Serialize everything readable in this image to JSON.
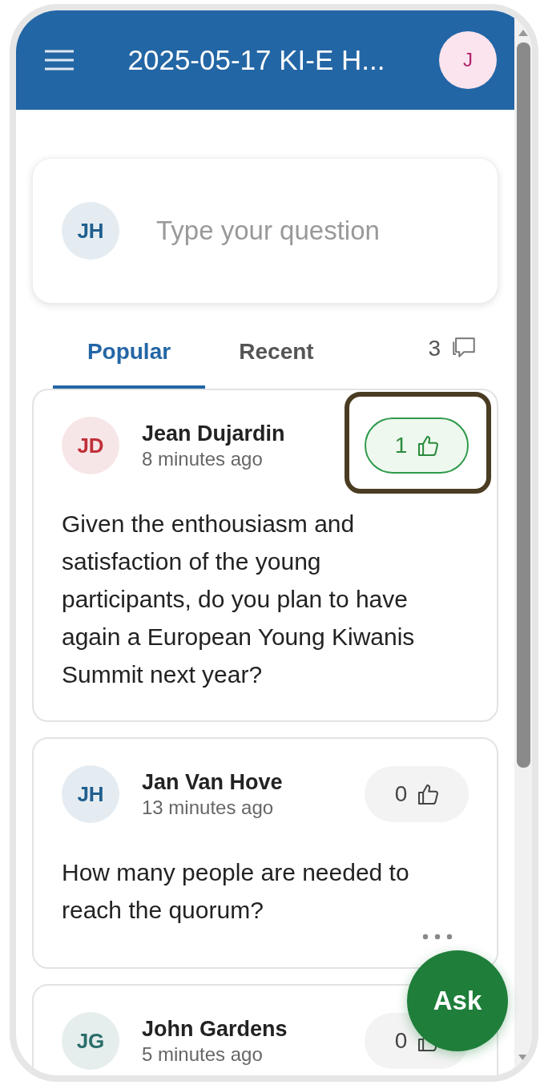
{
  "header": {
    "title": "2025-05-17 KI-E H...",
    "user_initials": "J"
  },
  "composer": {
    "initials": "JH",
    "color": "#1f5f8f",
    "placeholder": "Type your question"
  },
  "tabs": [
    {
      "label": "Popular",
      "selected": true
    },
    {
      "label": "Recent",
      "selected": false
    }
  ],
  "question_count": "3",
  "questions": [
    {
      "initials": "JD",
      "color": "#c0303a",
      "author": "Jean Dujardin",
      "time": "8 minutes ago",
      "votes": "1",
      "voted": true,
      "highlighted": true,
      "menu_visible": false,
      "text": "Given the enthousiasm and satisfaction of the young participants, do you plan to have again a European Young Kiwanis Summit next year?"
    },
    {
      "initials": "JH",
      "color": "#1f5f8f",
      "author": "Jan Van Hove",
      "time": "13 minutes ago",
      "votes": "0",
      "voted": false,
      "highlighted": false,
      "menu_visible": true,
      "text": "How many people are needed to reach the quorum?"
    },
    {
      "initials": "JG",
      "color": "#2a6e6a",
      "author": "John Gardens",
      "time": "5 minutes ago",
      "votes": "0",
      "voted": false,
      "highlighted": false,
      "menu_visible": false
    }
  ],
  "ask_button": {
    "label": "Ask"
  }
}
